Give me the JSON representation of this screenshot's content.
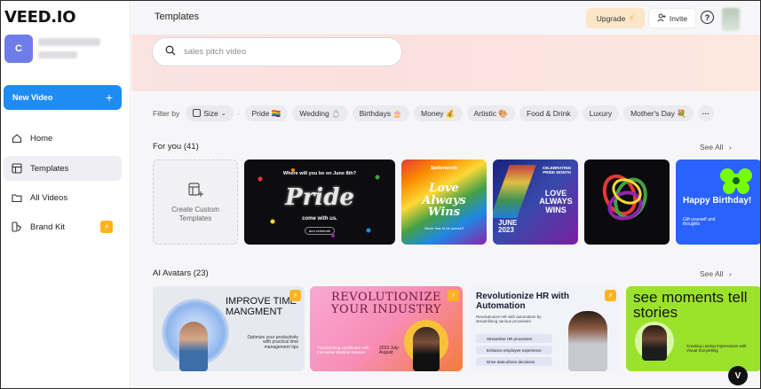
{
  "sidebar": {
    "logo": "VEED.IO",
    "avatar_letter": "C",
    "new_video_label": "New Video",
    "items": [
      {
        "label": "Home",
        "icon": "home-icon"
      },
      {
        "label": "Templates",
        "icon": "templates-icon",
        "active": true
      },
      {
        "label": "All Videos",
        "icon": "folder-icon"
      },
      {
        "label": "Brand Kit",
        "icon": "brand-kit-icon"
      }
    ]
  },
  "header": {
    "title": "Templates",
    "upgrade_label": "Upgrade",
    "invite_label": "Invite",
    "help_label": "?"
  },
  "search": {
    "placeholder": "sales pitch video"
  },
  "filters": {
    "label": "Filter by",
    "size_label": "Size",
    "chips": [
      "Pride 🏳️‍🌈",
      "Wedding 💍",
      "Birthdays 🎂",
      "Money 💰",
      "Artistic 🎨",
      "Food & Drink",
      "Luxury",
      "Mother's Day 💐"
    ],
    "more": "···"
  },
  "for_you": {
    "title": "For you (41)",
    "see_all": "See All",
    "create_label": "Create Custom Templates",
    "cards": [
      {
        "top": "Where will you be on June 8th?",
        "main": "Pride",
        "sub": "come with us.",
        "btn": "and celebrate"
      },
      {
        "top": "Spiderwomb",
        "main": "Love Always Wins",
        "sub": "Never fear to be yourself"
      },
      {
        "top": "CELEBRATING PRIDE MONTH",
        "main": "LOVE ALWAYS WINS",
        "sub": "JUNE 2023"
      },
      {
        "main": ""
      },
      {
        "main": "Happy Birthday!",
        "sub": "Gift yourself and thoughts"
      }
    ]
  },
  "ai_avatars": {
    "title": "AI Avatars (23)",
    "see_all": "See All",
    "cards": [
      {
        "main": "IMPROVE TIME MANGMENT",
        "sub": "Optimize your productivity with practical time management tips"
      },
      {
        "main": "REVOLUTIONIZE YOUR INDUSTRY",
        "sub": "Transforming Healthcare with Innovative Medical Devices",
        "date": "2023 July-August"
      },
      {
        "main": "Revolutionize HR with Automation",
        "sub": "Revolutionize HR with automation by streamlining various processes",
        "items": [
          "Streamline HR processes",
          "Enhance employee experience",
          "Drive data-driven decisions"
        ]
      },
      {
        "main": "see moments tell stories",
        "sub": "Creating Lasting Impressions with Visual Storytelling"
      }
    ]
  },
  "colors": {
    "accent": "#1f8cf3",
    "badge": "#ffb21e",
    "hero_bg": "#fbe3e2"
  }
}
